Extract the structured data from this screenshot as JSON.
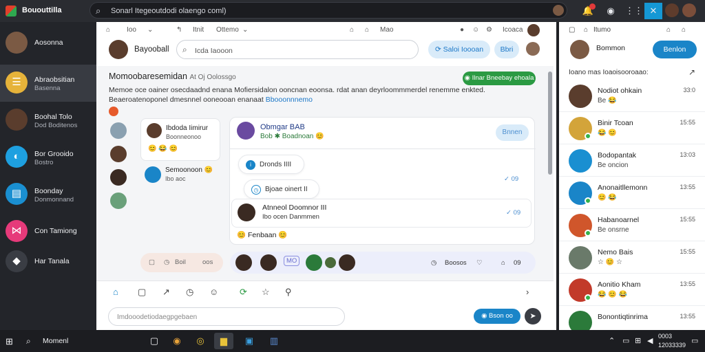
{
  "topbar": {
    "brand": "Bououttilla",
    "search_text": "Sonarl Itegeoutdodi olaengo coml)",
    "icons": [
      "bell-icon",
      "shield-icon",
      "grid-icon",
      "chat-icon"
    ]
  },
  "sidebar": {
    "items": [
      {
        "title": "Aosonna",
        "subtitle": ""
      },
      {
        "title": "Abraobsitian",
        "subtitle": "Basenna"
      },
      {
        "title": "Boohal Tolo",
        "subtitle": "Dod Boditenos"
      },
      {
        "title": "Bor Grooido",
        "subtitle": "Bostro"
      },
      {
        "title": "Boonday",
        "subtitle": "Donmonnand"
      },
      {
        "title": "Con Tamiong",
        "subtitle": ""
      },
      {
        "title": "Har Tanala",
        "subtitle": ""
      }
    ]
  },
  "main": {
    "toolbar": [
      "Ioo",
      "Itnit",
      "Ottemo",
      "Mao",
      "Icoaca"
    ],
    "header_name": "Bayooball",
    "search_placeholder": "Icda Iaooon",
    "pill_label": "Saloi Ioooan",
    "pill2_label": "Bbri",
    "title": "Momoobaresemidan",
    "title_suffix": "At Oj Oolossgo",
    "desc_line1": "Memoe oce oainer osecdaadnd enana  Mofiersidalon ooncnan eoonsa. rdat anan deyrloommmerdel renemme enkted.",
    "desc_line2": "Beaeroatenoponel dmesnnel ooneooan enanaat",
    "desc_link": "Bbooonnnemo",
    "green_pill": "Ilnar Bneebay ehoala",
    "card": {
      "name": "Ibdoda Iimirur",
      "sub": "Boonneonoo",
      "reactions": "😊 😂 😊"
    },
    "item2": {
      "name": "Semoonoon 😊",
      "sub": "Ibo aoc"
    },
    "thread": {
      "name": "Obmgar BAB",
      "sub": "Bob ✱ Boadnoan 😊",
      "button": "Bnnen",
      "bubble1": "Dronds IIII",
      "bubble2": "Bjoae oinert II",
      "time1": "09",
      "time2": "09",
      "reply_name": "Atnneol Doomnor III",
      "reply_sub": "Ibo ocen Danmmen",
      "reaction": "😊 Fenbaan 😊"
    },
    "inputbar": {
      "label1": "Boil",
      "label2": "oos"
    },
    "avbar": {
      "tag": "MO",
      "time_label": "Boosos",
      "count": "09"
    },
    "compose_placeholder": "Imdooodetiodaegpgebaen",
    "send_label": "Bson oo"
  },
  "right": {
    "toolbar": [
      "Itumo"
    ],
    "header_name": "Bommon",
    "button": "Benlon",
    "section": "Ioano mas Ioaoisooroaao:",
    "contacts": [
      {
        "name": "Nodiot ohkain",
        "extra": "Be 😂",
        "time": "33:0"
      },
      {
        "name": "Binir Tcoan",
        "extra": "😂 😊",
        "time": "15:55"
      },
      {
        "name": "Bodopantak",
        "extra": "Be oncion",
        "time": "13:03"
      },
      {
        "name": "Anonaitllemonn",
        "extra": "😊 😂",
        "time": "13:55"
      },
      {
        "name": "Habanoarnel",
        "extra": "Be onsrne",
        "time": "15:55"
      },
      {
        "name": "Nemo Bais",
        "extra": "☆ 😊 ☆",
        "time": "15:55"
      },
      {
        "name": "Aonitio Kham",
        "extra": "😂 😊 😂",
        "time": "13:55"
      },
      {
        "name": "Bonontiqtinrima",
        "extra": "",
        "time": "13:55"
      }
    ]
  },
  "taskbar": {
    "search_text": "Momenl",
    "time": "0003",
    "date": "12033339"
  }
}
